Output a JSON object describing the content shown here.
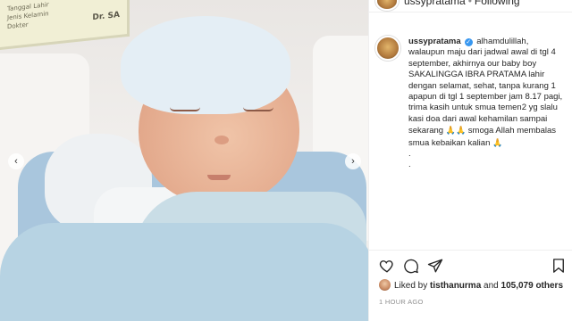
{
  "post": {
    "label_card": {
      "lines": [
        "Tanggal Lahir",
        "Jenis Kelamin",
        "Dokter"
      ],
      "doctor": "Dr. SA"
    },
    "header": {
      "username": "ussypratama",
      "separator": "•",
      "follow_label": "Following"
    },
    "caption": {
      "username": "ussypratama",
      "text": "alhamdulillah, walaupun maju dari jadwal awal di tgl 4 september, akhirnya our baby boy SAKALINGGA IBRA PRATAMA lahir dengan selamat, sehat, tanpa kurang 1 apapun di tgl 1 september jam 8.17 pagi, trima kasih untuk smua temen2 yg slalu kasi doa dari awal kehamilan sampai sekarang",
      "emoji_a": "🙏🙏",
      "text2": "smoga Allah membalas smua kebaikan kalian",
      "emoji_b": "🙏",
      "dots": [
        ".",
        "."
      ]
    },
    "likes": {
      "prefix": "Liked by",
      "first_user": "tisthanurma",
      "and": "and",
      "count": "105,079 others"
    },
    "time": "1 HOUR AGO"
  },
  "nav": {
    "prev": "‹",
    "next": "›"
  },
  "icons": {
    "like": "heart-icon",
    "comment": "comment-icon",
    "share": "share-icon",
    "save": "bookmark-icon",
    "verified": "verified-badge-icon"
  },
  "colors": {
    "verified": "#3897f0",
    "text": "#262626",
    "muted": "#8e8e8e"
  }
}
